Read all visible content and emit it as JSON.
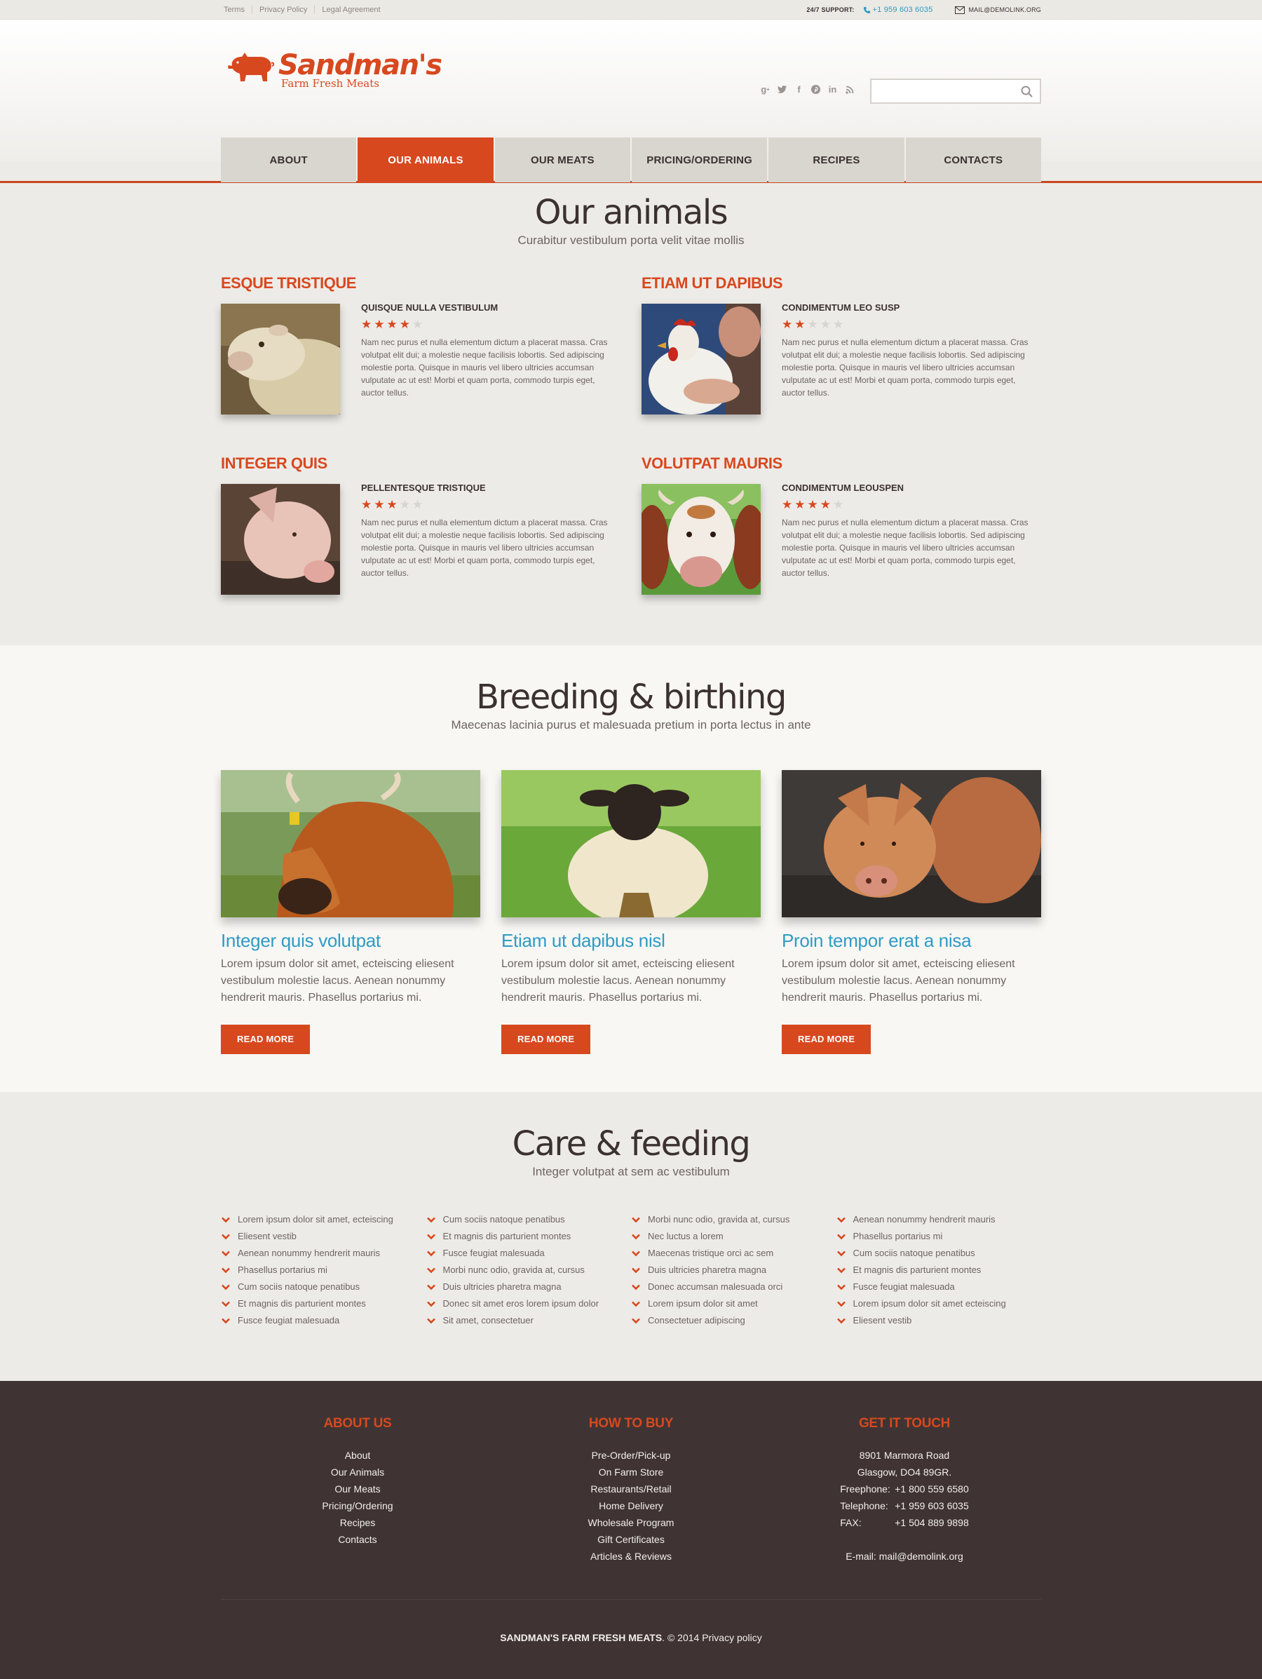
{
  "topbar": {
    "links": [
      "Terms",
      "Privacy Policy",
      "Legal Agreement"
    ],
    "support_label": "24/7 SUPPORT:",
    "phone": "+1 959 603 6035",
    "email": "MAIL@DEMOLINK.ORG"
  },
  "logo": {
    "title": "Sandman's",
    "subtitle": "Farm Fresh Meats"
  },
  "social": [
    "google-plus-icon",
    "twitter-icon",
    "facebook-icon",
    "pinterest-icon",
    "linkedin-icon",
    "rss-icon"
  ],
  "search": {
    "placeholder": "",
    "value": ""
  },
  "nav": [
    {
      "label": "ABOUT",
      "active": false
    },
    {
      "label": "OUR ANIMALS",
      "active": true
    },
    {
      "label": "OUR MEATS",
      "active": false
    },
    {
      "label": "PRICING/ORDERING",
      "active": false
    },
    {
      "label": "RECIPES",
      "active": false
    },
    {
      "label": "CONTACTS",
      "active": false
    }
  ],
  "colors": {
    "accent": "#d8481f",
    "link": "#2f9bc4",
    "dark": "#3f3433"
  },
  "animals": {
    "title": "Our animals",
    "subtitle": "Curabitur vestibulum porta velit vitae mollis",
    "items": [
      {
        "heading": "ESQUE TRISTIQUE",
        "subheading": "QUISQUE NULLA VESTIBULUM",
        "rating": 4,
        "image": "sheep-photo",
        "text": "Nam nec purus et nulla elementum dictum a placerat massa. Cras volutpat elit dui; a molestie neque facilisis lobortis. Sed adipiscing molestie porta. Quisque in mauris vel libero ultricies accumsan vulputate ac ut est! Morbi et quam porta, commodo turpis eget, auctor tellus."
      },
      {
        "heading": "ETIAM UT DAPIBUS",
        "subheading": "CONDIMENTUM LEO SUSP",
        "rating": 2,
        "image": "rooster-photo",
        "text": "Nam nec purus et nulla elementum dictum a placerat massa. Cras volutpat elit dui; a molestie neque facilisis lobortis. Sed adipiscing molestie porta. Quisque in mauris vel libero ultricies accumsan vulputate ac ut est! Morbi et quam porta, commodo turpis eget, auctor tellus."
      },
      {
        "heading": "INTEGER QUIS",
        "subheading": "PELLENTESQUE TRISTIQUE",
        "rating": 3,
        "image": "pig-photo",
        "text": "Nam nec purus et nulla elementum dictum a placerat massa. Cras volutpat elit dui; a molestie neque facilisis lobortis. Sed adipiscing molestie porta. Quisque in mauris vel libero ultricies accumsan vulputate ac ut est! Morbi et quam porta, commodo turpis eget, auctor tellus."
      },
      {
        "heading": "VOLUTPAT MAURIS",
        "subheading": "CONDIMENTUM LEOUSPEN",
        "rating": 4,
        "image": "cow-photo",
        "text": "Nam nec purus et nulla elementum dictum a placerat massa. Cras volutpat elit dui; a molestie neque facilisis lobortis. Sed adipiscing molestie porta. Quisque in mauris vel libero ultricies accumsan vulputate ac ut est! Morbi et quam porta, commodo turpis eget, auctor tellus."
      }
    ]
  },
  "breeding": {
    "title": "Breeding & birthing",
    "subtitle": "Maecenas lacinia purus et malesuada pretium in porta lectus in ante",
    "items": [
      {
        "title": "Integer quis volutpat",
        "text": "Lorem ipsum dolor sit amet, ecteiscing eliesent vestibulum molestie lacus. Aenean nonummy hendrerit mauris. Phasellus portarius mi.",
        "button": "READ MORE",
        "image": "cow-photo"
      },
      {
        "title": "Etiam ut dapibus nisl",
        "text": "Lorem ipsum dolor sit amet, ecteiscing eliesent vestibulum molestie lacus. Aenean nonummy hendrerit mauris. Phasellus portarius mi.",
        "button": "READ MORE",
        "image": "sheep-photo"
      },
      {
        "title": "Proin tempor erat a nisa",
        "text": "Lorem ipsum dolor sit amet, ecteiscing eliesent vestibulum molestie lacus. Aenean nonummy hendrerit mauris. Phasellus portarius mi.",
        "button": "READ MORE",
        "image": "pig-photo"
      }
    ]
  },
  "care": {
    "title": "Care & feeding",
    "subtitle": "Integer volutpat at sem ac vestibulum",
    "columns": [
      [
        "Lorem ipsum dolor sit amet, ecteiscing",
        "Eliesent vestib",
        "Aenean nonummy hendrerit mauris",
        "Phasellus portarius mi",
        "Cum sociis natoque penatibus",
        "Et magnis dis parturient montes",
        "Fusce feugiat malesuada"
      ],
      [
        "Cum sociis natoque penatibus",
        "Et magnis dis parturient montes",
        "Fusce feugiat malesuada",
        "Morbi nunc odio, gravida at, cursus",
        "Duis ultricies pharetra magna",
        "Donec sit amet eros lorem ipsum dolor",
        "Sit amet, consectetuer"
      ],
      [
        "Morbi nunc odio, gravida at, cursus",
        "Nec luctus a lorem",
        "Maecenas tristique orci ac sem",
        "Duis ultricies pharetra magna",
        "Donec accumsan malesuada orci",
        "Lorem ipsum dolor sit amet",
        "Consectetuer adipiscing"
      ],
      [
        "Aenean nonummy hendrerit mauris",
        "Phasellus portarius mi",
        "Cum sociis natoque penatibus",
        "Et magnis dis parturient montes",
        "Fusce feugiat malesuada",
        "Lorem ipsum dolor sit amet ecteiscing",
        "Eliesent vestib"
      ]
    ]
  },
  "footer": {
    "about": {
      "title": "ABOUT US",
      "links": [
        "About",
        "Our Animals",
        "Our Meats",
        "Pricing/Ordering",
        "Recipes",
        "Contacts"
      ]
    },
    "howtobuy": {
      "title": "HOW TO BUY",
      "links": [
        "Pre-Order/Pick-up",
        "On Farm Store",
        "Restaurants/Retail",
        "Home Delivery",
        "Wholesale Program",
        "Gift Certificates",
        "Articles & Reviews"
      ]
    },
    "contact": {
      "title": "GET IT TOUCH",
      "address1": "8901 Marmora Road",
      "address2": "Glasgow, DO4 89GR.",
      "freephone_label": "Freephone:",
      "freephone": "+1 800 559 6580",
      "telephone_label": "Telephone:",
      "telephone": "+1 959 603 6035",
      "fax_label": "FAX:",
      "fax": "+1 504 889 9898",
      "email": "E-mail: mail@demolink.org"
    },
    "copyright_brand": "SANDMAN'S FARM FRESH MEATS",
    "copyright_rest": ". © 2014 Privacy policy"
  }
}
